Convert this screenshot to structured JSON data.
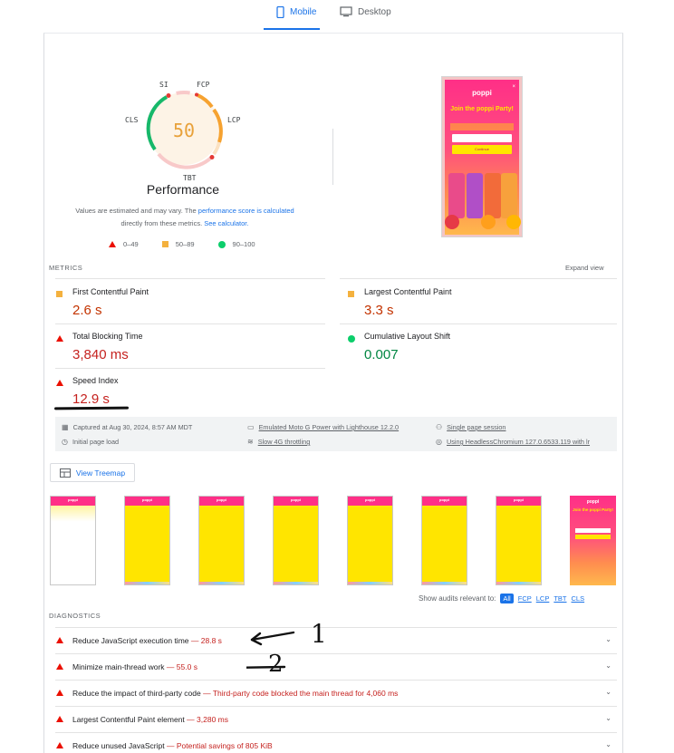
{
  "tabs": [
    {
      "label": "Mobile",
      "icon": "mobile-phone-icon",
      "active": true
    },
    {
      "label": "Desktop",
      "icon": "desktop-monitor-icon",
      "active": false
    }
  ],
  "performance": {
    "score": "50",
    "title": "Performance",
    "gauge_labels": {
      "si": "SI",
      "fcp": "FCP",
      "lcp": "LCP",
      "tbt": "TBT",
      "cls": "CLS"
    },
    "note_part1": "Values are estimated and may vary. The",
    "note_link1": "performance score is calculated",
    "note_part2": "directly from these metrics.",
    "note_link2": "See calculator."
  },
  "legend": [
    {
      "label": "0–49",
      "shape": "triangle",
      "color": "#eb0f00"
    },
    {
      "label": "50–89",
      "shape": "square",
      "color": "#f4b13e"
    },
    {
      "label": "90–100",
      "shape": "circle",
      "color": "#0cce6b"
    }
  ],
  "preview": {
    "logo": "poppi",
    "headline": "Join the poppi Party!",
    "button": "Continue"
  },
  "metrics": {
    "label": "METRICS",
    "expand": "Expand view",
    "items": [
      {
        "title": "First Contentful Paint",
        "value": "2.6 s",
        "status": "average"
      },
      {
        "title": "Largest Contentful Paint",
        "value": "3.3 s",
        "status": "average"
      },
      {
        "title": "Total Blocking Time",
        "value": "3,840 ms",
        "status": "fail"
      },
      {
        "title": "Cumulative Layout Shift",
        "value": "0.007",
        "status": "pass"
      },
      {
        "title": "Speed Index",
        "value": "12.9 s",
        "status": "fail"
      }
    ]
  },
  "info": {
    "captured": "Captured at Aug 30, 2024, 8:57 AM MDT",
    "page_load": "Initial page load",
    "device": "Emulated Moto G Power with Lighthouse 12.2.0",
    "throttling": "Slow 4G throttling",
    "session": "Single page session",
    "browser": "Using HeadlessChromium 127.0.6533.119 with lr"
  },
  "treemap": {
    "label": "View Treemap"
  },
  "filmstrip": {
    "logo": "poppi",
    "final_headline": "Join the poppi Party!"
  },
  "audits_filter": {
    "label": "Show audits relevant to:",
    "options": [
      "All",
      "FCP",
      "LCP",
      "TBT",
      "CLS"
    ],
    "selected": "All"
  },
  "diagnostics": {
    "label": "DIAGNOSTICS",
    "items": [
      {
        "title": "Reduce JavaScript execution time",
        "sep": " — ",
        "detail": "28.8 s"
      },
      {
        "title": "Minimize main-thread work",
        "sep": " — ",
        "detail": "55.0 s"
      },
      {
        "title": "Reduce the impact of third-party code",
        "sep": " — ",
        "detail": "Third-party code blocked the main thread for 4,060 ms"
      },
      {
        "title": "Largest Contentful Paint element",
        "sep": " — ",
        "detail": "3,280 ms"
      },
      {
        "title": "Reduce unused JavaScript",
        "sep": " — ",
        "detail": "Potential savings of 805 KiB"
      }
    ]
  },
  "annotations": {
    "first": "1",
    "second": "2"
  },
  "colors": {
    "accent": "#1a73e8",
    "fail": "#eb0f00",
    "average": "#f4b13e",
    "pass": "#0cce6b"
  }
}
